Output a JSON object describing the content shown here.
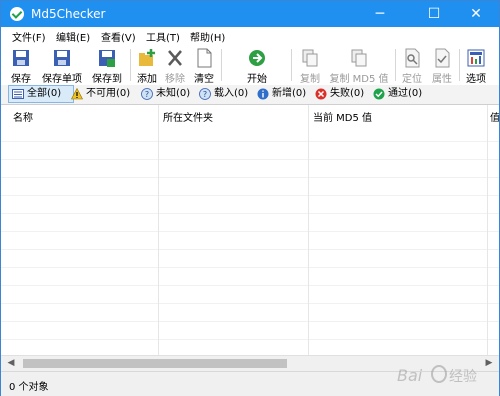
{
  "window": {
    "title": "Md5Checker",
    "minimize": "─",
    "maximize": "☐",
    "close": "✕"
  },
  "menu": [
    "文件(F)",
    "编辑(E)",
    "查看(V)",
    "工具(T)",
    "帮助(H)"
  ],
  "toolbar": {
    "save": "保存",
    "save_item": "保存单项",
    "save_to": "保存到",
    "add": "添加",
    "remove": "移除",
    "clear": "清空",
    "start": "开始",
    "copy": "复制",
    "copy_md5": "复制 MD5 值",
    "locate": "定位",
    "properties": "属性",
    "options": "选项"
  },
  "filters": {
    "all": "全部(0)",
    "unavailable": "不可用(0)",
    "unknown": "未知(0)",
    "loaded": "载入(0)",
    "new": "新增(0)",
    "failed": "失败(0)",
    "passed": "通过(0)"
  },
  "columns": {
    "name": "名称",
    "folder": "所在文件夹",
    "md5": "当前 MD5 值",
    "extra": "值"
  },
  "status": {
    "objects": "0 个对象"
  },
  "watermark": "Bai 经验",
  "colors": {
    "titlebar": "#1f8ff0",
    "accent": "#3a85d6"
  }
}
